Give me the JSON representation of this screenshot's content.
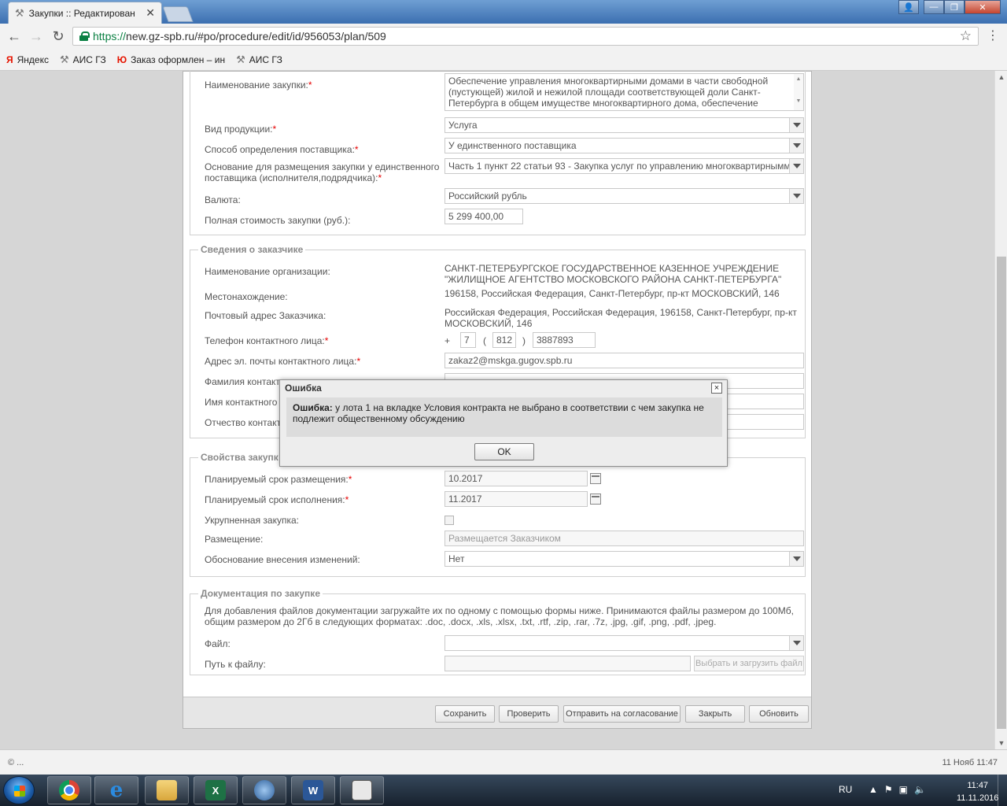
{
  "browser": {
    "tab_title": "Закупки :: Редактирован",
    "url_secure": "https://",
    "url_rest": "new.gz-spb.ru/#po/procedure/edit/id/956053/plan/509",
    "bookmarks": [
      "Яндекс",
      "АИС ГЗ",
      "Заказ оформлен – ин",
      "АИС ГЗ"
    ]
  },
  "form": {
    "purchase_name_label": "Наименование закупки:",
    "purchase_name_value": "Обеспечение управления многоквартирными домами в части свободной (пустующей) жилой и нежилой площади соответствующей доли Санкт-Петербурга в общем имуществе многоквартирного дома, обеспечение",
    "product_type_label": "Вид продукции:",
    "product_type_value": "Услуга",
    "supplier_method_label": "Способ определения поставщика:",
    "supplier_method_value": "У единственного поставщика",
    "basis_label_1": "Основание для размещения закупки у единственного",
    "basis_label_2": "поставщика (исполнителя,подрядчика):",
    "basis_value": "Часть 1 пункт 22 статьи 93 -  Закупка услуг по управлению многоквартирнымм",
    "currency_label": "Валюта:",
    "currency_value": "Российский рубль",
    "total_cost_label": "Полная стоимость закупки (руб.):",
    "total_cost_value": "5 299 400,00",
    "customer_legend": "Сведения о заказчике",
    "org_name_label": "Наименование организации:",
    "org_name_value_1": "САНКТ-ПЕТЕРБУРГСКОЕ ГОСУДАРСТВЕННОЕ КАЗЕННОЕ УЧРЕЖДЕНИЕ",
    "org_name_value_2": "\"ЖИЛИЩНОЕ АГЕНТСТВО МОСКОВСКОГО РАЙОНА САНКТ-ПЕТЕРБУРГА\"",
    "location_label": "Местонахождение:",
    "location_value": "196158, Российская Федерация, Санкт-Петербург, пр-кт МОСКОВСКИЙ, 146",
    "postal_label": "Почтовый адрес Заказчика:",
    "postal_value_1": "Российская Федерация, Российская Федерация, 196158, Санкт-Петербург, пр-кт",
    "postal_value_2": "МОСКОВСКИЙ, 146",
    "phone_label": "Телефон контактного лица:",
    "phone_plus": "+",
    "phone_country": "7",
    "phone_open": "(",
    "phone_code": "812",
    "phone_close": ")",
    "phone_number": "3887893",
    "email_label": "Адрес эл. почты контактного лица:",
    "email_value": "zakaz2@mskga.gugov.spb.ru",
    "surname_label": "Фамилия контакт",
    "firstname_label": "Имя контактного л",
    "patronymic_label": "Отчество контакт",
    "props_legend": "Свойства закупк",
    "plan_place_label": "Планируемый срок размещения:",
    "plan_place_value": "10.2017",
    "plan_exec_label": "Планируемый срок исполнения:",
    "plan_exec_value": "11.2017",
    "consolidated_label": "Укрупненная закупка:",
    "placement_label": "Размещение:",
    "placement_value": "Размещается Заказчиком",
    "change_reason_label": "Обоснование внесения изменений:",
    "change_reason_value": "Нет",
    "docs_legend": "Документация по закупке",
    "docs_info_1": "Для добавления файлов документации загружайте их по одному с помощью формы ниже. Принимаются файлы размером до 100Мб,",
    "docs_info_2": "общим размером до 2Гб в следующих форматах: .doc, .docx, .xls, .xlsx, .txt, .rtf, .zip, .rar, .7z, .jpg, .gif, .png, .pdf, .jpeg.",
    "file_label": "Файл:",
    "filepath_label": "Путь к файлу:",
    "upload_button": "Выбрать и загрузить файл"
  },
  "footer_buttons": {
    "save": "Сохранить",
    "check": "Проверить",
    "send": "Отправить на согласование",
    "close": "Закрыть",
    "refresh": "Обновить"
  },
  "modal": {
    "title": "Ошибка",
    "msg_bold": "Ошибка:",
    "msg_text": " у лота 1 на вкладке Условия контракта не выбрано в соответствии с чем закупка не подлежит общественному обсуждению",
    "ok": "OK",
    "close_glyph": "×"
  },
  "status": {
    "left": "© ...",
    "right": "11 Нояб 11:47"
  },
  "taskbar": {
    "lang": "RU",
    "time": "11:47",
    "date": "11.11.2016"
  }
}
